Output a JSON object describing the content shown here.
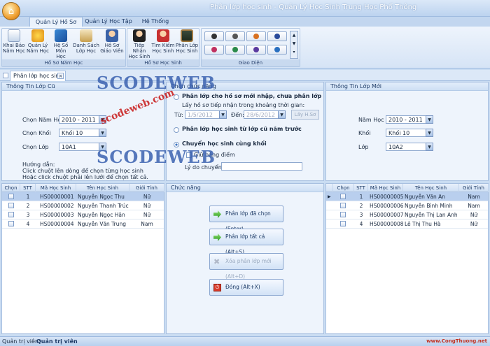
{
  "window": {
    "title": "Phân lớp học sinh - Quản Lý Học Sinh Trung Học Phổ Thông"
  },
  "ribbon_tabs": [
    "Quản Lý Hồ Sơ",
    "Quản Lý Học Tập",
    "Hệ Thống"
  ],
  "ribbon": {
    "group1_label": "Hồ Sơ Năm Học",
    "group1": [
      {
        "l1": "Khai Báo",
        "l2": "Năm Học"
      },
      {
        "l1": "Quản Lý",
        "l2": "Năm Học"
      },
      {
        "l1": "Hệ Số",
        "l2": "Môn Học"
      },
      {
        "l1": "Danh Sách",
        "l2": "Lớp Học"
      },
      {
        "l1": "Hồ Sơ",
        "l2": "Giáo Viên"
      }
    ],
    "group2_label": "Hồ Sơ Học Sinh",
    "group2": [
      {
        "l1": "Tiếp Nhận",
        "l2": "Học Sinh"
      },
      {
        "l1": "Tìm Kiếm",
        "l2": "Học Sinh"
      },
      {
        "l1": "Phân Lớp",
        "l2": "Học Sinh"
      }
    ],
    "group3_label": "Giao Diện"
  },
  "doc_tab": "Phân lớp học sinh",
  "left_panel": {
    "title": "Thông Tin Lớp Cũ",
    "year_label": "Chọn Năm Học",
    "year_value": "2010 - 2011",
    "grade_label": "Chọn Khối",
    "grade_value": "Khối 10",
    "class_label": "Chọn Lớp",
    "class_value": "10A1",
    "guide_title": "Hướng dẫn:",
    "guide_1": "Click chuột lên dòng để chọn từng học sinh",
    "guide_2": "Hoặc click chuột phải lên lưới để chọn tất cả."
  },
  "mid_panel": {
    "title": "Chọn chức năng",
    "opt1": "Phân lớp cho hồ sơ mới nhập, chưa phân lớp",
    "opt1_sub": "Lấy hồ sơ tiếp nhận trong khoảng thời gian:",
    "from_label": "Từ:",
    "from_value": "1/5/2012",
    "to_label": "Đến:",
    "to_value": "28/6/2012",
    "get_btn": "Lấy H.Sơ",
    "opt2": "Phân lớp học sinh từ lớp cũ năm trước",
    "opt3": "Chuyển học sinh cùng khối",
    "keep_scores": "Giữ bảng điểm",
    "reason_label": "Lý do chuyển"
  },
  "right_panel": {
    "title": "Thông Tin Lớp Mới",
    "year_label": "Năm Học",
    "year_value": "2010 - 2011",
    "grade_label": "Khối",
    "grade_value": "Khối 10",
    "class_label": "Lớp",
    "class_value": "10A2"
  },
  "grid_headers": [
    "Chọn",
    "STT",
    "Mã Học Sinh",
    "Tên Học Sinh",
    "Giới Tính"
  ],
  "left_grid": [
    {
      "stt": "1",
      "id": "HS00000001",
      "name": "Nguyễn Ngọc Thu",
      "gender": "Nữ"
    },
    {
      "stt": "2",
      "id": "HS00000002",
      "name": "Nguyễn Thanh Trúc",
      "gender": "Nữ"
    },
    {
      "stt": "3",
      "id": "HS00000003",
      "name": "Nguyễn Ngọc Hân",
      "gender": "Nữ"
    },
    {
      "stt": "4",
      "id": "HS00000004",
      "name": "Nguyễn Văn Trung",
      "gender": "Nam"
    }
  ],
  "right_grid": [
    {
      "stt": "1",
      "id": "HS00000005",
      "name": "Nguyễn Văn An",
      "gender": "Nam"
    },
    {
      "stt": "2",
      "id": "HS00000006",
      "name": "Nguyễn Bình Minh",
      "gender": "Nam"
    },
    {
      "stt": "3",
      "id": "HS00000007",
      "name": "Nguyễn Thị Lan Anh",
      "gender": "Nữ"
    },
    {
      "stt": "4",
      "id": "HS00000008",
      "name": "Lê Thị Thu Hà",
      "gender": "Nữ"
    }
  ],
  "function_panel": {
    "title": "Chức năng",
    "btn_assign_selected": "Phân lớp đã chọn (Enter)",
    "btn_assign_all": "Phân lớp tất cả (Alt+S)",
    "btn_remove": "Xóa phân lớp mới (Alt+D)",
    "btn_close": "Đóng (Alt+X)"
  },
  "status": {
    "label": "Quản trị viên:",
    "user": "Quản trị viên",
    "watermark": "www.CongThuong.net"
  },
  "watermarks": {
    "scodeweb": "SCODEWEB",
    "url": "scodeweb.com"
  },
  "colors": {
    "accent": "#3b62b0",
    "selection": "#b9cfee"
  }
}
